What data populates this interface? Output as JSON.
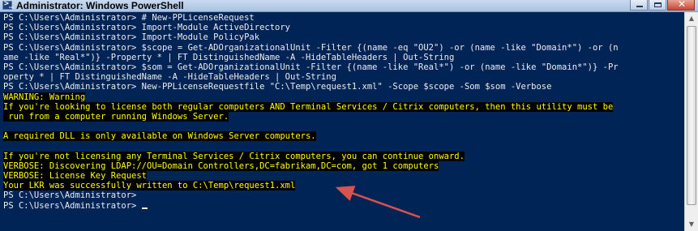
{
  "window": {
    "title": "Administrator: Windows PowerShell",
    "icon": "powershell-icon",
    "icon_glyph": ">_",
    "controls": [
      "minimize-icon",
      "maximize-icon",
      "close-icon"
    ],
    "close_glyph": "✕"
  },
  "console": {
    "background_color": "#012456",
    "text_color": "#eeedf0",
    "warning_color": "#ffff00",
    "lines": [
      "PS C:\\Users\\Administrator> # New-PPLicenseRequest",
      "PS C:\\Users\\Administrator> Import-Module ActiveDirectory",
      "PS C:\\Users\\Administrator> Import-Module PolicyPak",
      "PS C:\\Users\\Administrator> $scope = Get-ADOrganizationalUnit -Filter {(name -eq \"OU2\") -or (name -like \"Domain*\") -or (n",
      "ame -like \"Real*\")} -Property * | FT DistinguishedName -A -HideTableHeaders | Out-String",
      "PS C:\\Users\\Administrator> $som = Get-ADOrganizationalUnit -Filter {(name -like \"Real*\") -or (name -like \"Domain*\")} -Pr",
      "operty * | FT DistinguishedName -A -HideTableHeaders | Out-String",
      "PS C:\\Users\\Administrator> New-PPLicenseRequestfile \"C:\\Temp\\request1.xml\" -Scope $scope -Som $som -Verbose",
      "WARNING: Warning",
      "If you're looking to license both regular computers AND Terminal Services / Citrix computers, then this utility must be",
      " run from a computer running Windows Server.",
      "",
      "A required DLL is only available on Windows Server computers.",
      "",
      "If you're not licensing any Terminal Services / Citrix computers, you can continue onward.",
      "VERBOSE: Discovering LDAP://OU=Domain Controllers,DC=fabrikam,DC=com, got 1 computers",
      "VERBOSE: License Key Request",
      "Your LKR was successfully written to C:\\Temp\\request1.xml",
      "PS C:\\Users\\Administrator>",
      "PS C:\\Users\\Administrator> "
    ]
  },
  "scrollbar": {
    "up_icon": "scroll-up-arrow-icon",
    "up_glyph": "▲",
    "down_icon": "scroll-down-arrow-icon",
    "down_glyph": "▼"
  },
  "annotation": {
    "icon": "red-arrow-annotation-icon",
    "color": "#d9534f"
  }
}
